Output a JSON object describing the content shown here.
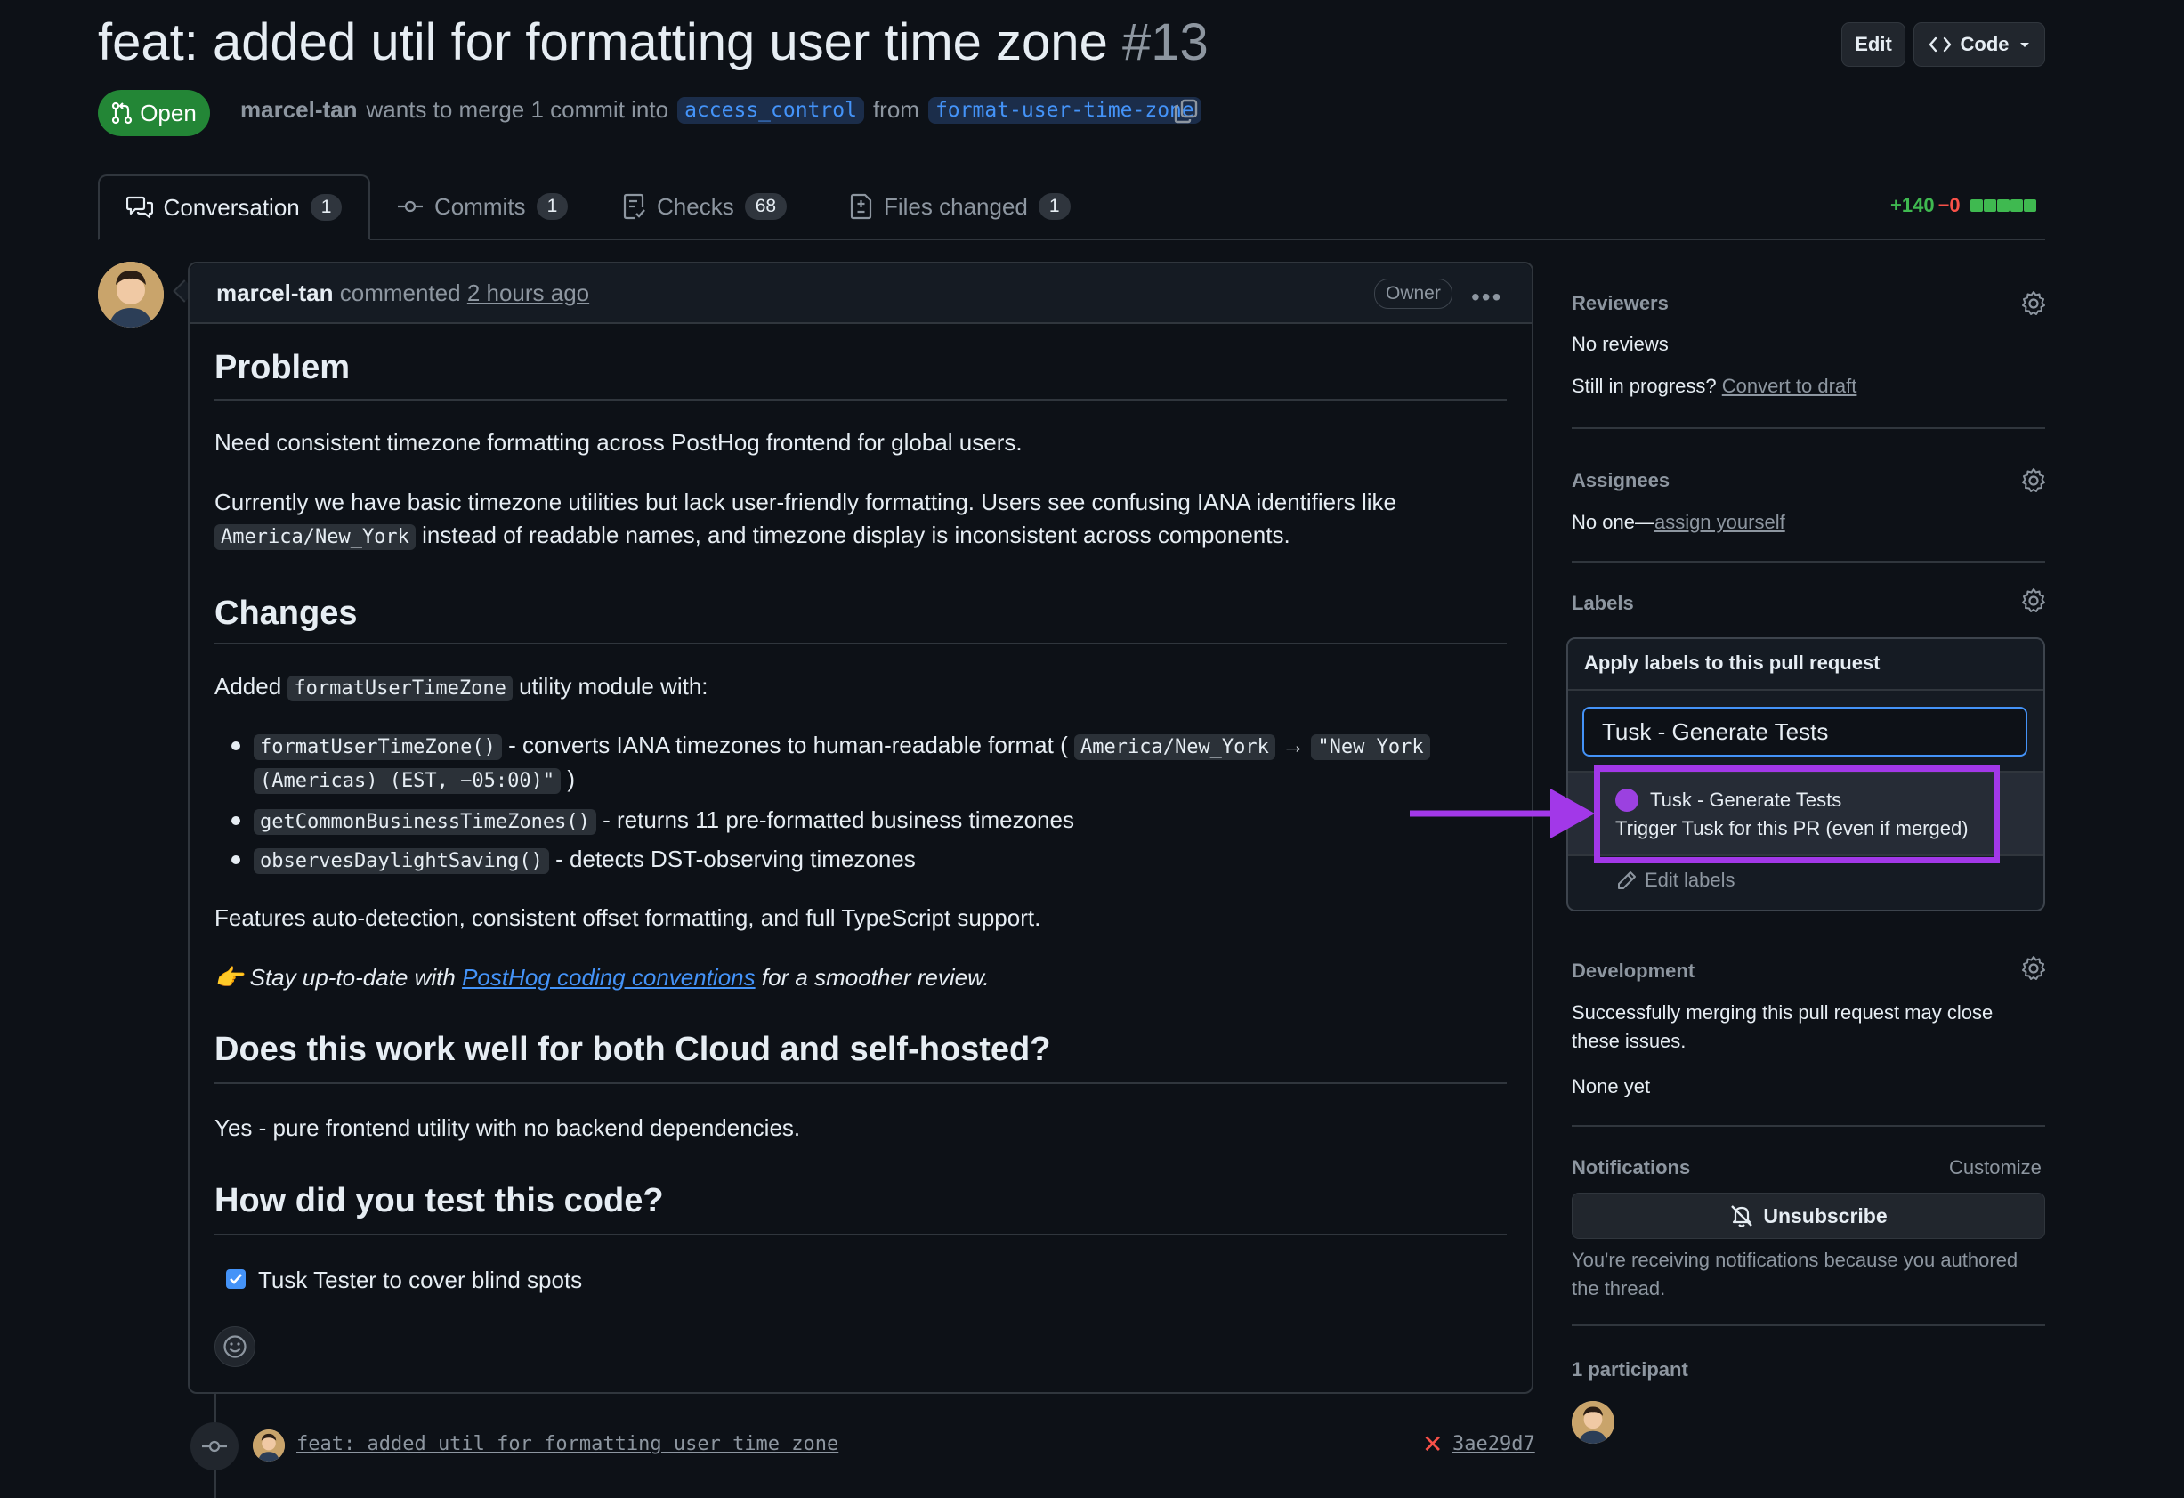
{
  "header": {
    "title": "feat: added util for formatting user time zone",
    "number": "#13",
    "edit_label": "Edit",
    "code_label": "Code",
    "state": "Open",
    "author": "marcel-tan",
    "merge_text_1": "wants to merge 1 commit into",
    "base_branch": "access_control",
    "merge_text_2": "from",
    "head_branch": "format-user-time-zone"
  },
  "tabs": [
    {
      "label": "Conversation",
      "count": "1"
    },
    {
      "label": "Commits",
      "count": "1"
    },
    {
      "label": "Checks",
      "count": "68"
    },
    {
      "label": "Files changed",
      "count": "1"
    }
  ],
  "diffstat": {
    "additions": "+140",
    "deletions": "−0"
  },
  "comment": {
    "author": "marcel-tan",
    "action": "commented",
    "time": "2 hours ago",
    "badge": "Owner",
    "h_problem": "Problem",
    "p1": "Need consistent timezone formatting across PostHog frontend for global users.",
    "p2a": "Currently we have basic timezone utilities but lack user-friendly formatting. Users see confusing IANA identifiers like",
    "p2_code": "America/New_York",
    "p2b": "instead of readable names, and timezone display is inconsistent across components.",
    "h_changes": "Changes",
    "added_a": "Added",
    "added_code": "formatUserTimeZone",
    "added_b": "utility module with:",
    "b1_code": "formatUserTimeZone()",
    "b1_text": "- converts IANA timezones to human-readable format (",
    "b1_code2": "America/New_York",
    "b1_arrow": "→",
    "b1_code3": "\"New York",
    "b1_code4": "(Americas) (EST, −05:00)\"",
    "b1_end": ")",
    "b2_code": "getCommonBusinessTimeZones()",
    "b2_text": "- returns 11 pre-formatted business timezones",
    "b3_code": "observesDaylightSaving()",
    "b3_text": "- detects DST-observing timezones",
    "features": "Features auto-detection, consistent offset formatting, and full TypeScript support.",
    "stay_emoji": "👉",
    "stay_a": "Stay up-to-date with",
    "stay_link": "PostHog coding conventions",
    "stay_b": "for a smoother review.",
    "h_cloud": "Does this work well for both Cloud and self-hosted?",
    "cloud_answer": "Yes - pure frontend utility with no backend dependencies.",
    "h_test": "How did you test this code?",
    "task": "Tusk Tester to cover blind spots"
  },
  "timeline_commit": {
    "message": "feat: added util for formatting user time zone",
    "status": "✕",
    "sha": "3ae29d7"
  },
  "sidebar": {
    "reviewers_h": "Reviewers",
    "reviewers_v": "No reviews",
    "progress_a": "Still in progress?",
    "progress_link": "Convert to draft",
    "assignees_h": "Assignees",
    "assignees_a": "No one—",
    "assignees_link": "assign yourself",
    "labels_h": "Labels",
    "dev_h": "Development",
    "dev_text1": "Successfully merging this pull request may close",
    "dev_text2": "these issues.",
    "dev_none": "None yet",
    "notif_h": "Notifications",
    "notif_customize": "Customize",
    "unsubscribe": "Unsubscribe",
    "notif_text1": "You're receiving notifications because you authored",
    "notif_text2": "the thread.",
    "participants_h": "1 participant"
  },
  "label_popup": {
    "title": "Apply labels to this pull request",
    "search_value": "Tusk - Generate Tests",
    "option_name": "Tusk - Generate Tests",
    "option_desc": "Trigger Tusk for this PR (even if merged)",
    "option_color": "#9b41e0",
    "edit_labels": "Edit labels"
  },
  "colors": {
    "accent": "#4493f8",
    "open": "#238636",
    "annotation": "#a238e8"
  }
}
